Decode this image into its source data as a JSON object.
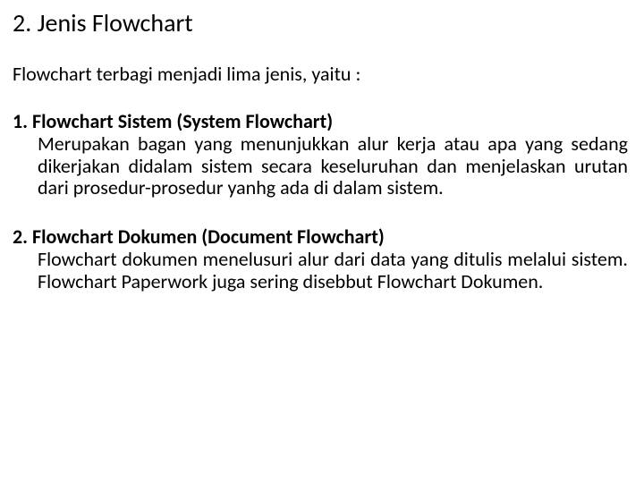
{
  "title": "2. Jenis Flowchart",
  "intro": "Flowchart terbagi menjadi lima jenis, yaitu :",
  "sections": [
    {
      "heading": "1. Flowchart Sistem (System Flowchart)",
      "body": "Merupakan bagan yang menunjukkan alur kerja atau apa yang sedang dikerjakan didalam sistem secara keseluruhan dan menjelaskan urutan dari prosedur-prosedur yanhg ada di dalam sistem."
    },
    {
      "heading": "2. Flowchart Dokumen (Document Flowchart)",
      "body": "Flowchart dokumen menelusuri alur dari data yang ditulis melalui sistem. Flowchart Paperwork juga sering disebbut Flowchart Dokumen."
    }
  ]
}
